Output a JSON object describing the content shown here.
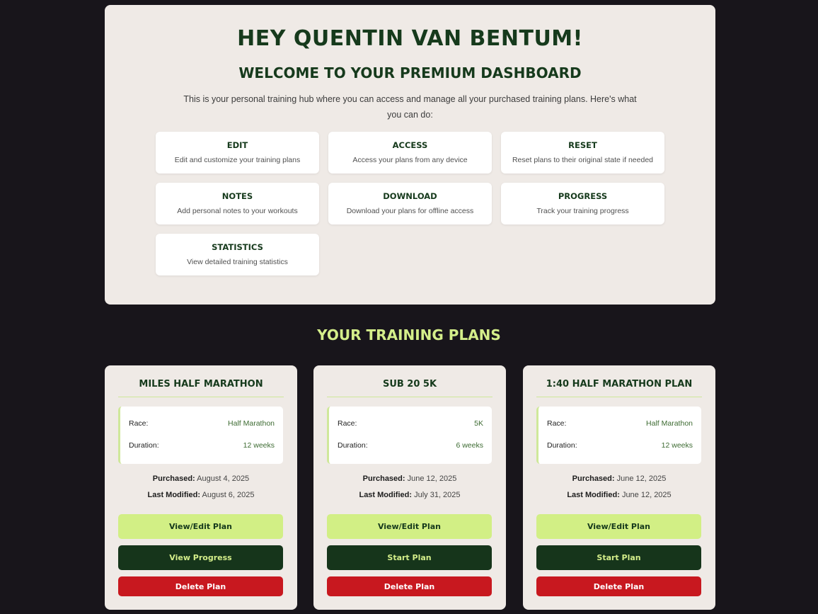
{
  "hero": {
    "title": "HEY QUENTIN VAN BENTUM!",
    "subtitle": "WELCOME TO YOUR PREMIUM DASHBOARD",
    "description": "This is your personal training hub where you can access and manage all your purchased training plans. Here's what you can do:"
  },
  "features": [
    {
      "title": "EDIT",
      "desc": "Edit and customize your training plans"
    },
    {
      "title": "ACCESS",
      "desc": "Access your plans from any device"
    },
    {
      "title": "RESET",
      "desc": "Reset plans to their original state if needed"
    },
    {
      "title": "NOTES",
      "desc": "Add personal notes to your workouts"
    },
    {
      "title": "DOWNLOAD",
      "desc": "Download your plans for offline access"
    },
    {
      "title": "PROGRESS",
      "desc": "Track your training progress"
    },
    {
      "title": "STATISTICS",
      "desc": "View detailed training statistics"
    }
  ],
  "plans_section": {
    "title": "YOUR TRAINING PLANS"
  },
  "labels": {
    "race": "Race:",
    "duration": "Duration:",
    "purchased": "Purchased:",
    "last_modified": "Last Modified:"
  },
  "plans": [
    {
      "name": "MILES HALF MARATHON",
      "race": "Half Marathon",
      "duration": "12 weeks",
      "purchased": "August 4, 2025",
      "last_modified": "August 6, 2025",
      "primary_label": "View/Edit Plan",
      "secondary_label": "View Progress",
      "delete_label": "Delete Plan"
    },
    {
      "name": "SUB 20 5K",
      "race": "5K",
      "duration": "6 weeks",
      "purchased": "June 12, 2025",
      "last_modified": "July 31, 2025",
      "primary_label": "View/Edit Plan",
      "secondary_label": "Start Plan",
      "delete_label": "Delete Plan"
    },
    {
      "name": "1:40 HALF MARATHON PLAN",
      "race": "Half Marathon",
      "duration": "12 weeks",
      "purchased": "June 12, 2025",
      "last_modified": "June 12, 2025",
      "primary_label": "View/Edit Plan",
      "secondary_label": "Start Plan",
      "delete_label": "Delete Plan"
    }
  ],
  "colors": {
    "page_background": "#18151b",
    "panel_background": "#efeae6",
    "brand_dark_green": "#163a1c",
    "accent_lime": "#d2ef85",
    "danger_red": "#c8181f"
  }
}
